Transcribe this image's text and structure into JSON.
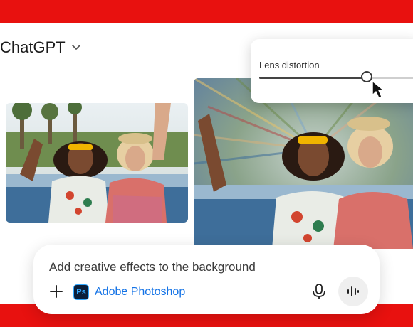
{
  "header": {
    "app_title": "ChatGPT",
    "dropdown_icon": "chevron-down-icon"
  },
  "lens_panel": {
    "label": "Lens distortion",
    "slider_value": 0.63,
    "cursor_icon": "pointer-cursor-icon"
  },
  "prompt": {
    "text": "Add creative effects to the background",
    "plus_icon": "plus-icon",
    "app_chip": {
      "icon_text": "Ps",
      "label": "Adobe Photoshop"
    },
    "mic_icon": "microphone-icon",
    "voice_icon": "voice-waveform-icon"
  },
  "colors": {
    "brand_red": "#e8110f",
    "photoshop_blue": "#31a8ff",
    "link_blue": "#1473e6"
  }
}
